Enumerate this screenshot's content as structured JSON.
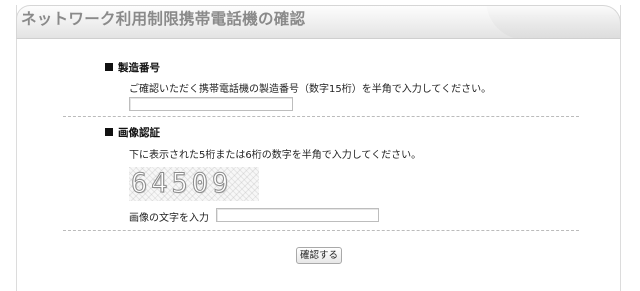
{
  "header": {
    "title": "ネットワーク利用制限携帯電話機の確認"
  },
  "serial_section": {
    "title": "製造番号",
    "description": "ご確認いただく携帯電話機の製造番号（数字15桁）を半角で入力してください。",
    "input_value": "",
    "input_placeholder": ""
  },
  "captcha_section": {
    "title": "画像認証",
    "description": "下に表示された5桁または6桁の数字を半角で入力してください。",
    "captcha_text": "64509",
    "input_label": "画像の文字を入力",
    "input_value": "",
    "input_placeholder": ""
  },
  "actions": {
    "confirm_label": "確認する"
  }
}
